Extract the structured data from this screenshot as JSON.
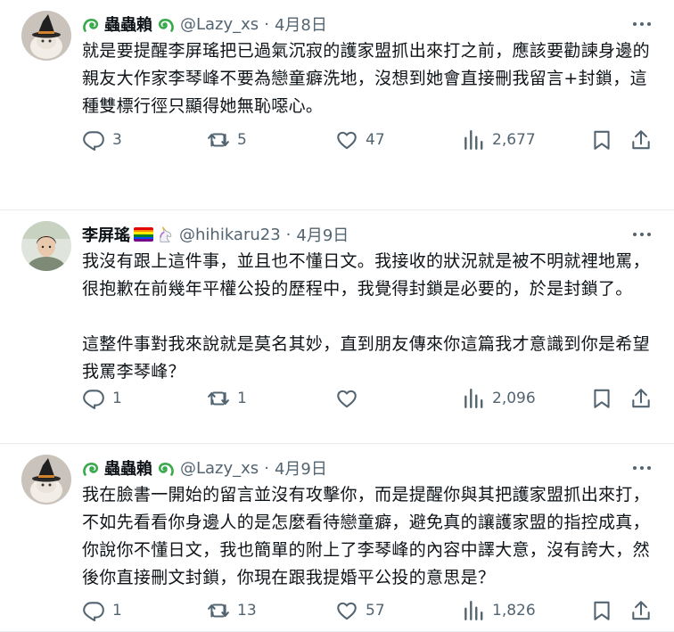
{
  "tweets": [
    {
      "name": "蟲蟲賴",
      "handle": "@Lazy_xs",
      "separator": "·",
      "date": "4月8日",
      "paragraphs": [
        "就是要提醒李屏瑤把已過氣沉寂的護家盟抓出來打之前，應該要勸諫身邊的親友大作家李琴峰不要為戀童癖洗地，沒想到她會直接刪我留言+封鎖，這種雙標行徑只顯得她無恥噁心。"
      ],
      "replies": "3",
      "retweets": "5",
      "likes": "47",
      "views": "2,677"
    },
    {
      "name": "李屏瑤",
      "handle": "@hihikaru23",
      "separator": "·",
      "date": "4月9日",
      "paragraphs": [
        "我沒有跟上這件事，並且也不懂日文。我接收的狀況就是被不明就裡地罵，很抱歉在前幾年平權公投的歷程中，我覺得封鎖是必要的，於是封鎖了。",
        "這整件事對我來說就是莫名其妙，直到朋友傳來你這篇我才意識到你是希望我罵李琴峰？"
      ],
      "replies": "1",
      "retweets": "1",
      "likes": "",
      "views": "2,096"
    },
    {
      "name": "蟲蟲賴",
      "handle": "@Lazy_xs",
      "separator": "·",
      "date": "4月9日",
      "paragraphs": [
        "我在臉書一開始的留言並沒有攻擊你，而是提醒你與其把護家盟抓出來打，不如先看看你身邊人的是怎麼看待戀童癖，避免真的讓護家盟的指控成真，你說你不懂日文，我也簡單的附上了李琴峰的內容中譯大意，沒有誇大，然後你直接刪文封鎖，你現在跟我提婚平公投的意思是？"
      ],
      "replies": "1",
      "retweets": "13",
      "likes": "57",
      "views": "1,826"
    }
  ],
  "icons": {
    "reply": "reply-icon",
    "retweet": "retweet-icon",
    "like": "heart-icon",
    "views": "views-icon",
    "bookmark": "bookmark-icon",
    "share": "share-icon",
    "more": "more-icon",
    "snail": "snail-emoji-icon",
    "flag": "rainbow-flag-icon",
    "unicorn": "unicorn-emoji-icon"
  },
  "colors": {
    "text": "#0f1419",
    "secondary": "#536471",
    "divider": "#e6ecf0",
    "snail_green": "#3aa94e"
  }
}
